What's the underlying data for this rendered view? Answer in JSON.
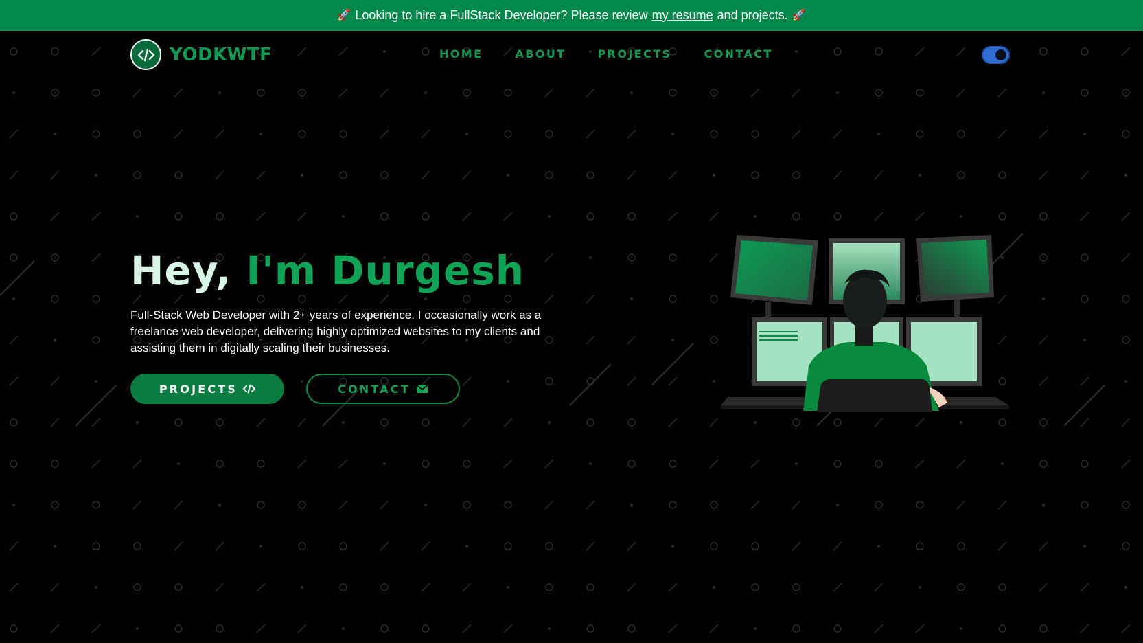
{
  "banner": {
    "prefix": "Looking to hire a FullStack Developer? Please review",
    "link_text": "my resume",
    "suffix": "and projects.",
    "rocket_icon": "rocket-icon"
  },
  "nav": {
    "logo_text": "YODKWTF",
    "logo_icon": "code-icon",
    "links": [
      "HOME",
      "ABOUT",
      "PROJECTS",
      "CONTACT"
    ],
    "theme_toggle": "dark"
  },
  "hero": {
    "greeting": "Hey,",
    "name": "I'm Durgesh",
    "description": "Full-Stack Web Developer with 2+ years of experience. I occasionally work as a freelance web developer, delivering highly optimized websites to my clients and assisting them in digitally scaling their businesses.",
    "projects_button": "PROJECTS",
    "projects_icon": "code-icon",
    "contact_button": "CONTACT",
    "contact_icon": "envelope-icon"
  },
  "colors": {
    "accent": "#10a356",
    "banner_bg": "#02884a",
    "background": "#000000",
    "toggle": "#2f6bd1"
  }
}
